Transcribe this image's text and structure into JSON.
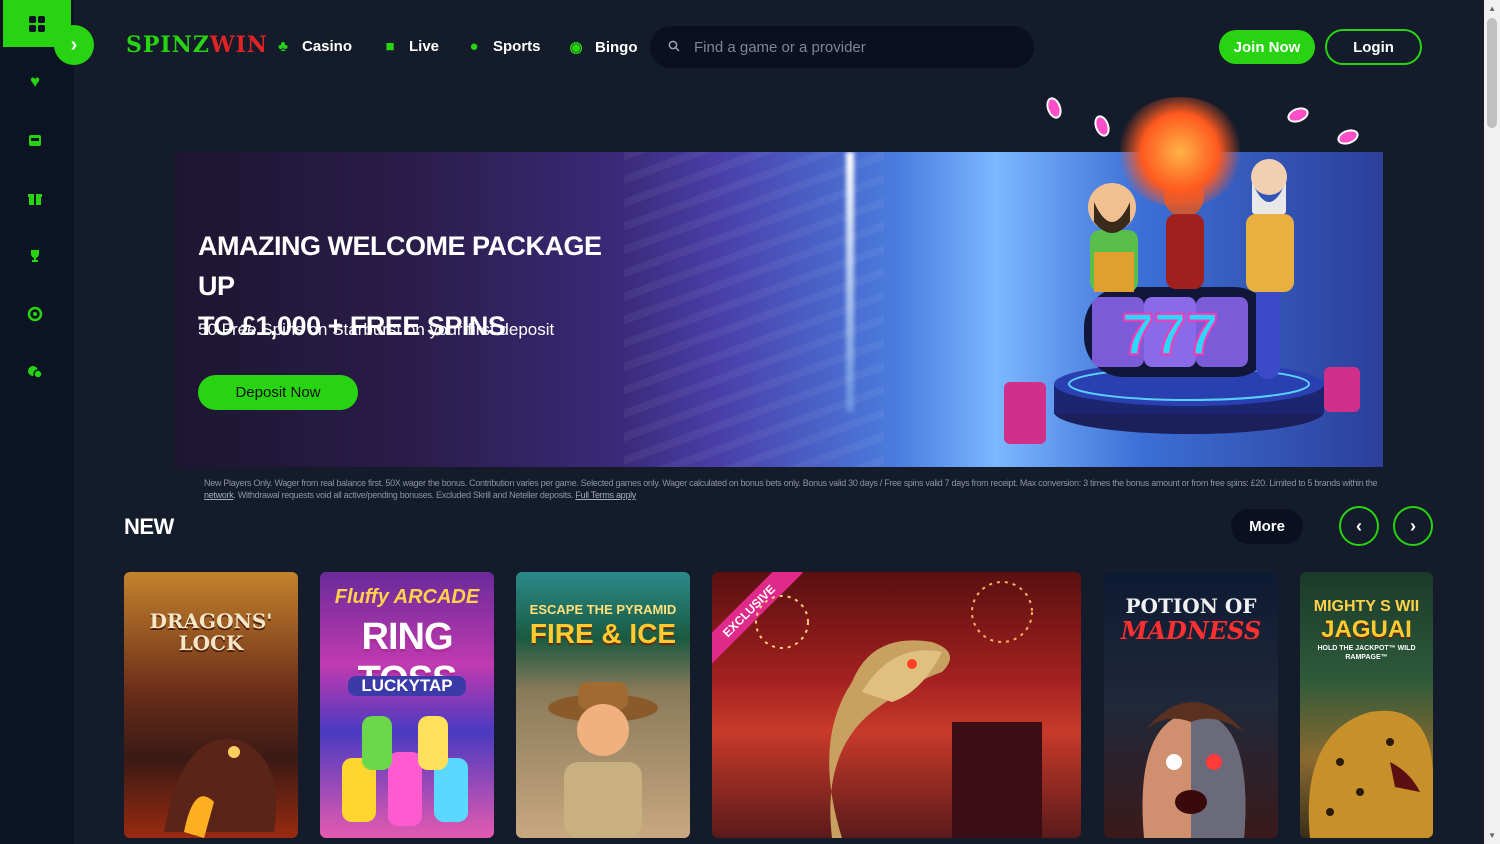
{
  "colors": {
    "accent": "#28d411",
    "background": "#141b2b",
    "sidebar": "#0c1322",
    "logo_red": "#e02424"
  },
  "logo": {
    "part1": "SPINZ",
    "part2": "WIN"
  },
  "nav": [
    {
      "label": "Casino",
      "icon": "cards-icon"
    },
    {
      "label": "Live",
      "icon": "live-dealer-icon"
    },
    {
      "label": "Sports",
      "icon": "sports-ball-icon"
    },
    {
      "label": "Bingo",
      "icon": "bingo-icon"
    }
  ],
  "search": {
    "placeholder": "Find a game or a provider"
  },
  "header_buttons": {
    "join": "Join Now",
    "login": "Login"
  },
  "sidebar": {
    "items": [
      {
        "name": "favourites",
        "icon": "heart-icon"
      },
      {
        "name": "casino",
        "icon": "slot-machine-icon"
      },
      {
        "name": "promotions",
        "icon": "gift-icon"
      },
      {
        "name": "tournaments",
        "icon": "trophy-icon"
      },
      {
        "name": "sports",
        "icon": "football-icon"
      },
      {
        "name": "support",
        "icon": "chat-icon"
      }
    ]
  },
  "banner": {
    "title_line1": "AMAZING WELCOME PACKAGE UP",
    "title_line2": "TO £1,000 + FREE SPINS",
    "subtitle": "50 Free Spins on Starburst on your first deposit",
    "cta": "Deposit Now",
    "reel": "777"
  },
  "terms": {
    "text_before": "New Players Only. Wager from real balance first. 50X wager the bonus. Contribution varies per game. Selected games only. Wager calculated on bonus bets only. Bonus valid 30 days / Free spins valid 7 days from receipt. Max conversion: 3 times the bonus amount or from free spins: £20. Limited to 5 brands within the",
    "network_link": "network",
    "text_after": ". Withdrawal requests void all active/pending bonuses. Excluded Skrill and Neteller deposits.",
    "full_terms_link": "Full Terms apply"
  },
  "new_section": {
    "title": "NEW",
    "more": "More",
    "games": [
      {
        "line1": "DRAGONS'",
        "line2": "LOCK"
      },
      {
        "line1": "Fluffy ARCADE",
        "line2": "RING TOSS",
        "line3": "LUCKYTAP"
      },
      {
        "line1": "ESCAPE THE PYRAMID",
        "line2": "FIRE & ICE"
      },
      {
        "badge": "EXCLUSIVE"
      },
      {
        "line1": "POTION OF",
        "line2": "MADNESS"
      },
      {
        "line1": "MIGHTY S WII",
        "line2": "JAGUAI",
        "line3": "HOLD THE JACKPOT™ WILD RAMPAGE™"
      }
    ]
  }
}
